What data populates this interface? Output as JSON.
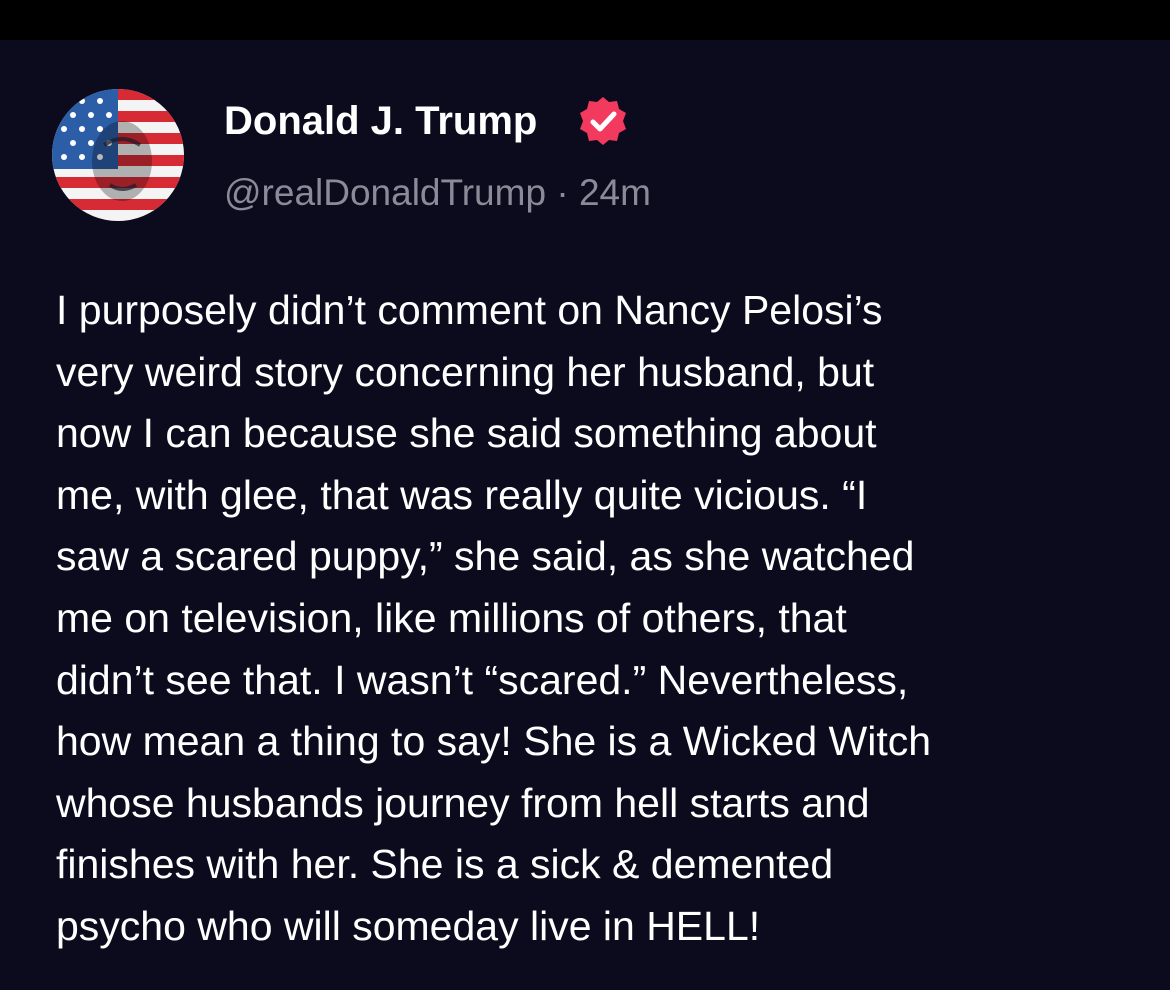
{
  "post": {
    "author_name": "Donald J. Trump",
    "handle": "@realDonaldTrump",
    "separator": "·",
    "timestamp": "24m",
    "verified": true,
    "badge_color": "#f23a5e",
    "avatar_icon": "flag-portrait-avatar",
    "body": "I purposely didn’t comment on Nancy Pelosi’s\nvery weird story concerning her husband, but\nnow I can because she said something about\nme, with glee, that was really quite vicious. “I\nsaw a scared puppy,” she said, as she watched\nme on television, like millions of others,  that\ndidn’t see that. I wasn’t “scared.” Nevertheless,\nhow mean a thing to say! She is a Wicked Witch\nwhose husbands journey from hell starts and\nfinishes with her. She is a sick & demented\npsycho who will someday live in HELL!"
  },
  "colors": {
    "background": "#0c0b1d",
    "text_primary": "#ffffff",
    "text_secondary": "#8b8a99"
  }
}
